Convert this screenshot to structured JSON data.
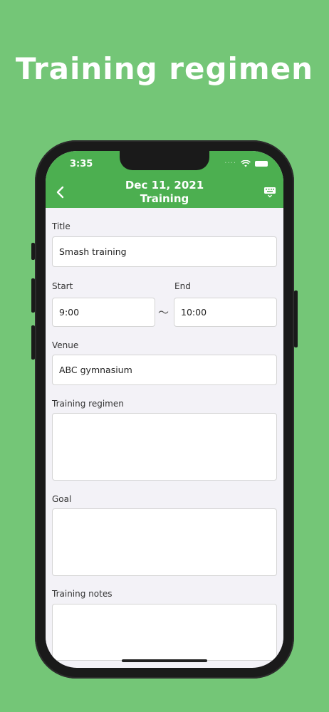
{
  "hero": {
    "title": "Training regimen"
  },
  "status_bar": {
    "time": "3:35"
  },
  "app_bar": {
    "date": "Dec 11, 2021",
    "subtitle": "Training",
    "back_icon": "chevron-left-icon",
    "keyboard_icon": "keyboard-hide-icon"
  },
  "form": {
    "title_label": "Title",
    "title_value": "Smash training",
    "start_label": "Start",
    "start_value": "9:00",
    "range_separator": "〜",
    "end_label": "End",
    "end_value": "10:00",
    "venue_label": "Venue",
    "venue_value": "ABC gymnasium",
    "regimen_label": "Training regimen",
    "regimen_value": "",
    "goal_label": "Goal",
    "goal_value": "",
    "notes_label": "Training notes",
    "notes_value": ""
  },
  "colors": {
    "background": "#74c677",
    "app_bar": "#4caf50",
    "form_background": "#f3f2f7"
  }
}
